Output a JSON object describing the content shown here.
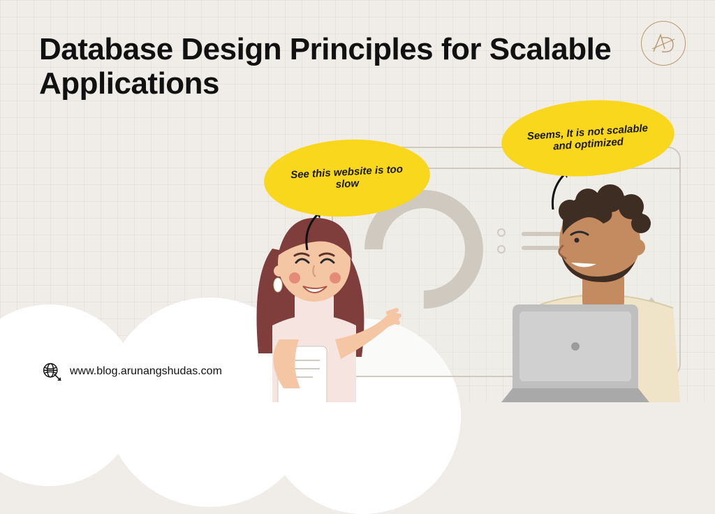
{
  "title": "Database Design Principles for Scalable Applications",
  "logo_text": "AD",
  "bubbles": {
    "left": "See this website is too slow",
    "right": "Seems, It is not scalable and optimized"
  },
  "footer": {
    "url": "www.blog.arunangshudas.com"
  },
  "colors": {
    "bg": "#f0ede8",
    "bubble": "#f9d71c",
    "logo_stroke": "#b9976a",
    "hair_woman": "#7f3e3b",
    "skin_woman": "#f4c6a4",
    "hair_man": "#3d2d22",
    "skin_man": "#c58b60",
    "shirt_man": "#efe3c8",
    "laptop": "#bfbfbf"
  }
}
